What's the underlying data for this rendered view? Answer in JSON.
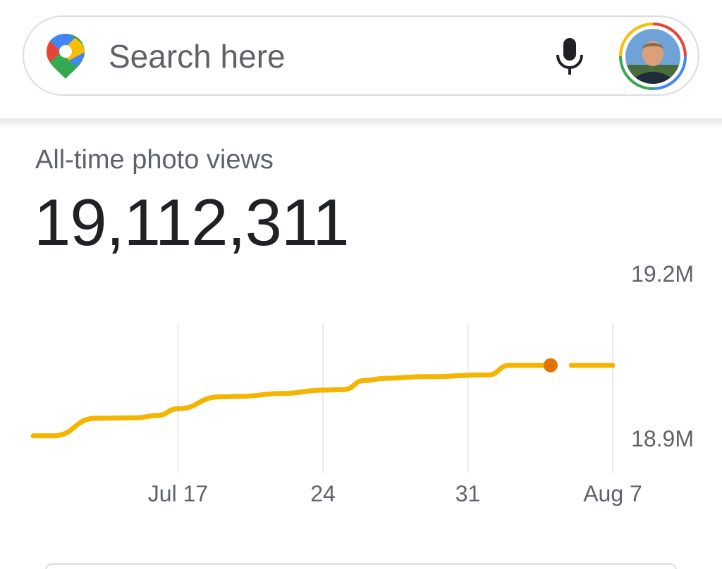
{
  "search": {
    "placeholder": "Search here",
    "mic_icon": "microphone-icon",
    "logo_icon": "google-maps-pin-icon",
    "avatar_icon": "user-avatar"
  },
  "stats": {
    "label": "All-time photo views",
    "value": "19,112,311"
  },
  "colors": {
    "line": "#f4b400",
    "current_point": "#e37400",
    "text_secondary": "#5f6368",
    "text_primary": "#202124"
  },
  "chart_data": {
    "type": "line",
    "title": "",
    "xlabel": "",
    "ylabel": "",
    "x_tick_labels": [
      "Jul 17",
      "24",
      "31",
      "Aug 7"
    ],
    "y_tick_labels": [
      "19.2M",
      "18.9M"
    ],
    "y_tick_values": [
      19200000,
      18900000
    ],
    "ylim": [
      18900000,
      19200000
    ],
    "xlim": [
      "Jul 10",
      "Aug 7"
    ],
    "series": [
      {
        "x": [
          "Jul 10",
          "Jul 11",
          "Jul 13",
          "Jul 15",
          "Jul 16",
          "Jul 17",
          "Jul 19",
          "Jul 20",
          "Jul 22",
          "Jul 24",
          "Jul 25",
          "Jul 26",
          "Jul 27",
          "Jul 29",
          "Aug 1",
          "Aug 2",
          "Aug 3",
          "Aug 4",
          "Aug 5",
          "Aug 6",
          "Aug 7"
        ],
        "values": [
          18904000,
          18904000,
          18935000,
          18936000,
          18940000,
          18952000,
          18973000,
          18974000,
          18979000,
          18985000,
          18986000,
          19002000,
          19006000,
          19009000,
          19012000,
          19029000,
          19029000,
          19029000,
          19029000,
          19029000,
          19029000
        ],
        "gaps_before": [
          18
        ]
      }
    ],
    "highlight_point": {
      "x": "Aug 4",
      "value": 19029000
    },
    "grid": "vertical"
  }
}
